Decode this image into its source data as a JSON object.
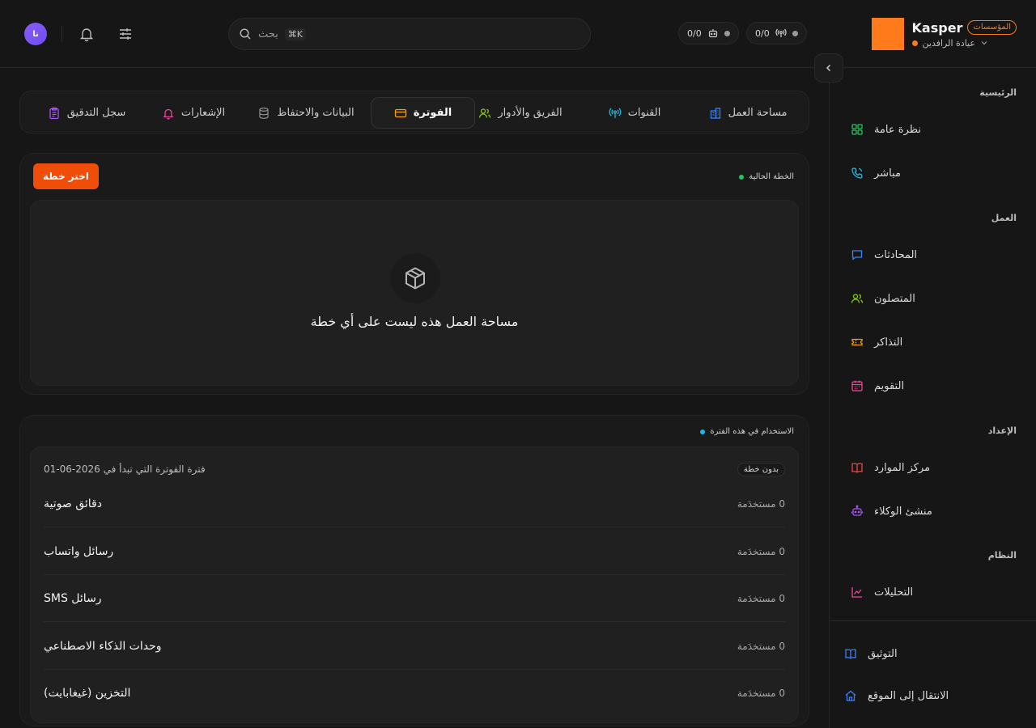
{
  "brand": {
    "name": "Kasper",
    "badge": "المؤسسات",
    "workspace": "عيادة الرافدين"
  },
  "header": {
    "counter_1": "0/0",
    "counter_2": "0/0",
    "search_label": "بحث",
    "search_shortcut": "⌘K",
    "avatar_initials": "نا"
  },
  "sidebar": {
    "sections": [
      {
        "title": "الرئيسية",
        "items": [
          {
            "label": "نظرة عامة",
            "icon": "grid-icon"
          },
          {
            "label": "مباشر",
            "icon": "phone-icon"
          }
        ]
      },
      {
        "title": "العمل",
        "items": [
          {
            "label": "المحادثات",
            "icon": "chat-icon"
          },
          {
            "label": "المتصلون",
            "icon": "users-icon"
          },
          {
            "label": "التذاكر",
            "icon": "ticket-icon"
          },
          {
            "label": "التقويم",
            "icon": "calendar-icon"
          }
        ]
      },
      {
        "title": "الإعداد",
        "items": [
          {
            "label": "مركز الموارد",
            "icon": "book-icon"
          },
          {
            "label": "منشئ الوكلاء",
            "icon": "bot-icon"
          }
        ]
      },
      {
        "title": "النظام",
        "items": [
          {
            "label": "التحليلات",
            "icon": "chart-icon"
          }
        ]
      }
    ],
    "footer": [
      {
        "label": "التوثيق",
        "icon": "docs-icon"
      },
      {
        "label": "الانتقال إلى الموقع",
        "icon": "home-icon"
      }
    ]
  },
  "tabs": [
    {
      "label": "مساحة العمل",
      "icon": "building-icon",
      "active": false
    },
    {
      "label": "القنوات",
      "icon": "antenna-icon",
      "active": false
    },
    {
      "label": "الفريق والأدوار",
      "icon": "users-icon",
      "active": false
    },
    {
      "label": "الفوترة",
      "icon": "card-icon",
      "active": true
    },
    {
      "label": "البيانات والاحتفاظ",
      "icon": "database-icon",
      "active": false
    },
    {
      "label": "الإشعارات",
      "icon": "bell-icon",
      "active": false
    },
    {
      "label": "سجل التدقيق",
      "icon": "clipboard-icon",
      "active": false
    }
  ],
  "current_plan": {
    "label": "الخطة الحالية",
    "choose_button": "اختر خطة",
    "empty_message": "مساحة العمل هذه ليست على أي خطة"
  },
  "usage": {
    "label": "الاستخدام في هذه الفترة",
    "period_text": "فترة الفوترة التي تبدأ في 2026-06-01",
    "badge": "بدون خطة",
    "rows": [
      {
        "name": "دقائق صوتية",
        "value": "0 مستخدَمة"
      },
      {
        "name": "رسائل واتساب",
        "value": "0 مستخدَمة"
      },
      {
        "name": "رسائل SMS",
        "value": "0 مستخدَمة"
      },
      {
        "name": "وحدات الذكاء الاصطناعي",
        "value": "0 مستخدَمة"
      },
      {
        "name": "التخزين (غيغابايت)",
        "value": "0 مستخدَمة"
      }
    ]
  },
  "colors": {
    "accent": "#f04d0a",
    "brand": "#ff7a1a",
    "plan_dot": "#22c55e",
    "usage_dot": "#22b8e6"
  }
}
